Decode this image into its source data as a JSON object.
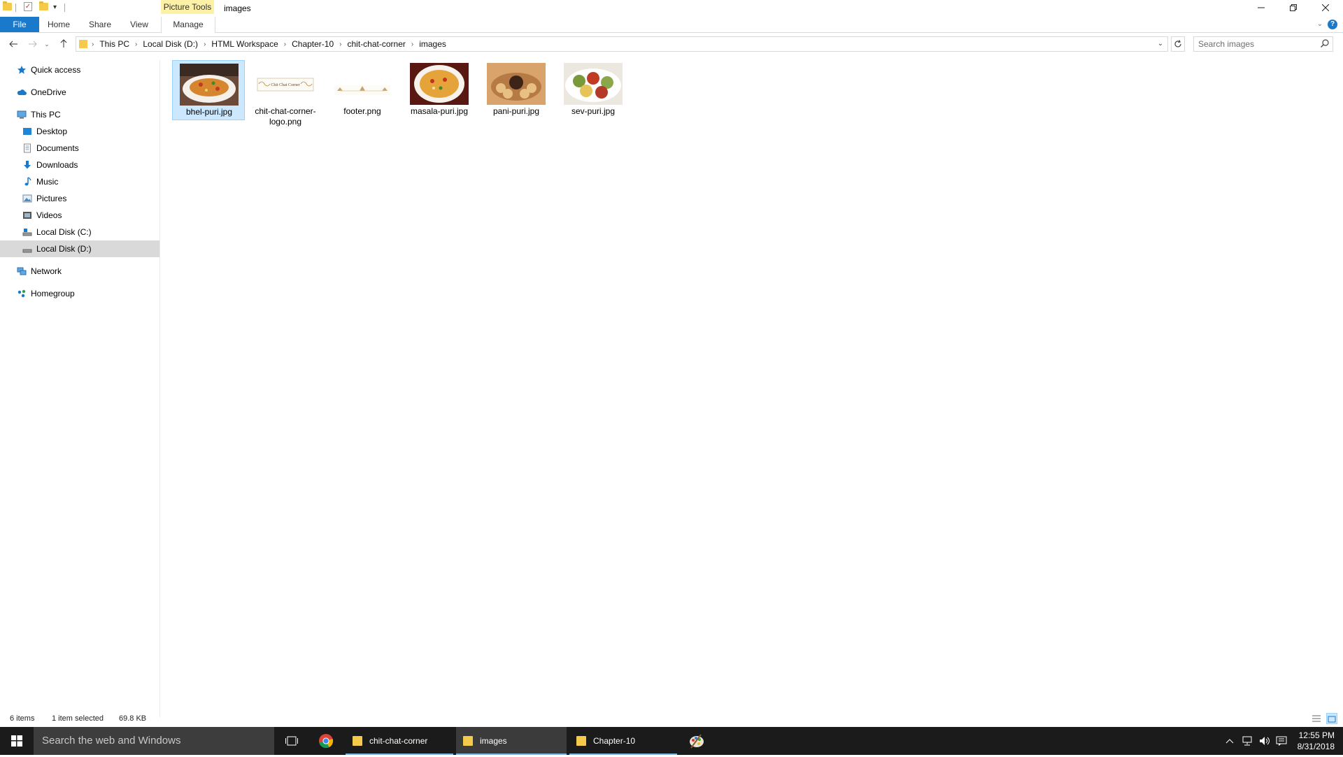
{
  "window": {
    "title": "images",
    "contextual_tab": "Picture Tools"
  },
  "ribbon": {
    "tabs": [
      "File",
      "Home",
      "Share",
      "View",
      "Manage"
    ]
  },
  "address": {
    "crumbs": [
      "This PC",
      "Local Disk (D:)",
      "HTML Workspace",
      "Chapter-10",
      "chit-chat-corner",
      "images"
    ]
  },
  "search": {
    "placeholder": "Search images"
  },
  "navigation": {
    "items": [
      {
        "label": "Quick access",
        "icon": "star-icon"
      },
      {
        "label": "OneDrive",
        "icon": "cloud-icon"
      },
      {
        "label": "This PC",
        "icon": "computer-icon"
      },
      {
        "label": "Desktop",
        "icon": "desktop-icon"
      },
      {
        "label": "Documents",
        "icon": "documents-icon"
      },
      {
        "label": "Downloads",
        "icon": "downloads-icon"
      },
      {
        "label": "Music",
        "icon": "music-icon"
      },
      {
        "label": "Pictures",
        "icon": "pictures-icon"
      },
      {
        "label": "Videos",
        "icon": "videos-icon"
      },
      {
        "label": "Local Disk (C:)",
        "icon": "drive-icon"
      },
      {
        "label": "Local Disk (D:)",
        "icon": "drive-icon"
      },
      {
        "label": "Network",
        "icon": "network-icon"
      },
      {
        "label": "Homegroup",
        "icon": "homegroup-icon"
      }
    ],
    "selected": "Local Disk (D:)"
  },
  "files": [
    {
      "name": "bhel-puri.jpg",
      "selected": true
    },
    {
      "name": "chit-chat-corner-logo.png",
      "selected": false,
      "thumb_text": "Chit Chat Corner"
    },
    {
      "name": "footer.png",
      "selected": false
    },
    {
      "name": "masala-puri.jpg",
      "selected": false
    },
    {
      "name": "pani-puri.jpg",
      "selected": false
    },
    {
      "name": "sev-puri.jpg",
      "selected": false
    }
  ],
  "status": {
    "item_count": "6 items",
    "selection": "1 item selected",
    "size": "69.8 KB"
  },
  "taskbar": {
    "search_placeholder": "Search the web and Windows",
    "apps": [
      "chit-chat-corner",
      "images",
      "Chapter-10"
    ],
    "active_app": "images",
    "time": "12:55 PM",
    "date": "8/31/2018"
  },
  "colors": {
    "accent": "#1979ca",
    "selection": "#cce8ff",
    "contextual_tab": "#fdf1a8",
    "taskbar": "#1b1b1b"
  }
}
